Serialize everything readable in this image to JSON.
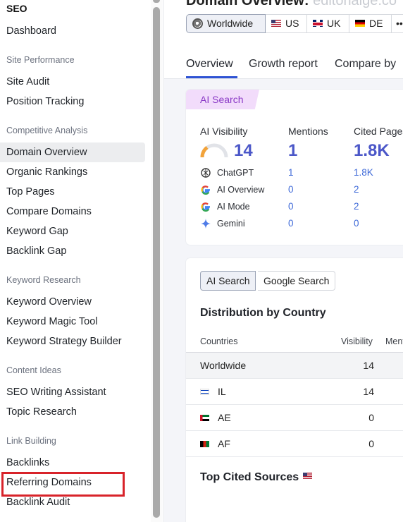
{
  "sidebar": {
    "title": "SEO",
    "items": {
      "dashboard": "Dashboard",
      "site_audit": "Site Audit",
      "position_tracking": "Position Tracking",
      "domain_overview": "Domain Overview",
      "organic_rankings": "Organic Rankings",
      "top_pages": "Top Pages",
      "compare_domains": "Compare Domains",
      "keyword_gap": "Keyword Gap",
      "backlink_gap": "Backlink Gap",
      "keyword_overview": "Keyword Overview",
      "keyword_magic_tool": "Keyword Magic Tool",
      "keyword_strategy_builder": "Keyword Strategy Builder",
      "seo_writing_assistant": "SEO Writing Assistant",
      "topic_research": "Topic Research",
      "backlinks": "Backlinks",
      "referring_domains": "Referring Domains",
      "backlink_audit": "Backlink Audit"
    },
    "sections": {
      "site_performance": "Site Performance",
      "competitive_analysis": "Competitive Analysis",
      "keyword_research": "Keyword Research",
      "content_ideas": "Content Ideas",
      "link_building": "Link Building"
    },
    "active_item": "Domain Overview",
    "highlighted_item": "Referring Domains",
    "highlight_color": "#d8232a"
  },
  "header": {
    "title_main": "Domain Overview:",
    "title_domain": "editorialge.co"
  },
  "databases": [
    {
      "label": "Worldwide",
      "icon": "globe-icon"
    },
    {
      "label": "US",
      "icon": "us-flag-icon"
    },
    {
      "label": "UK",
      "icon": "uk-flag-icon"
    },
    {
      "label": "DE",
      "icon": "de-flag-icon"
    }
  ],
  "tabs": [
    "Overview",
    "Growth report",
    "Compare by"
  ],
  "ai_card": {
    "chip": "AI Search",
    "metrics": {
      "visibility_label": "AI Visibility",
      "visibility_value": "14",
      "mentions_label": "Mentions",
      "mentions_value": "1",
      "cited_label": "Cited Pages",
      "cited_value": "1.8K"
    },
    "engines": [
      {
        "name": "ChatGPT",
        "icon": "chatgpt-icon",
        "mentions": "1",
        "cited": "1.8K"
      },
      {
        "name": "AI Overview",
        "icon": "google-icon",
        "mentions": "0",
        "cited": "2"
      },
      {
        "name": "AI Mode",
        "icon": "google-icon",
        "mentions": "0",
        "cited": "2"
      },
      {
        "name": "Gemini",
        "icon": "gemini-icon",
        "mentions": "0",
        "cited": "0"
      }
    ],
    "accent_color": "#4b57c8",
    "chip_color": "#f2dcfb"
  },
  "distribution": {
    "toggle": [
      "AI Search",
      "Google Search"
    ],
    "title": "Distribution by Country",
    "columns": [
      "Countries",
      "Visibility",
      "Mentions"
    ],
    "rows": [
      {
        "country": "Worldwide",
        "visibility": "14"
      },
      {
        "country": "IL",
        "visibility": "14"
      },
      {
        "country": "AE",
        "visibility": "0"
      },
      {
        "country": "AF",
        "visibility": "0"
      }
    ],
    "sources_title": "Top Cited Sources"
  }
}
